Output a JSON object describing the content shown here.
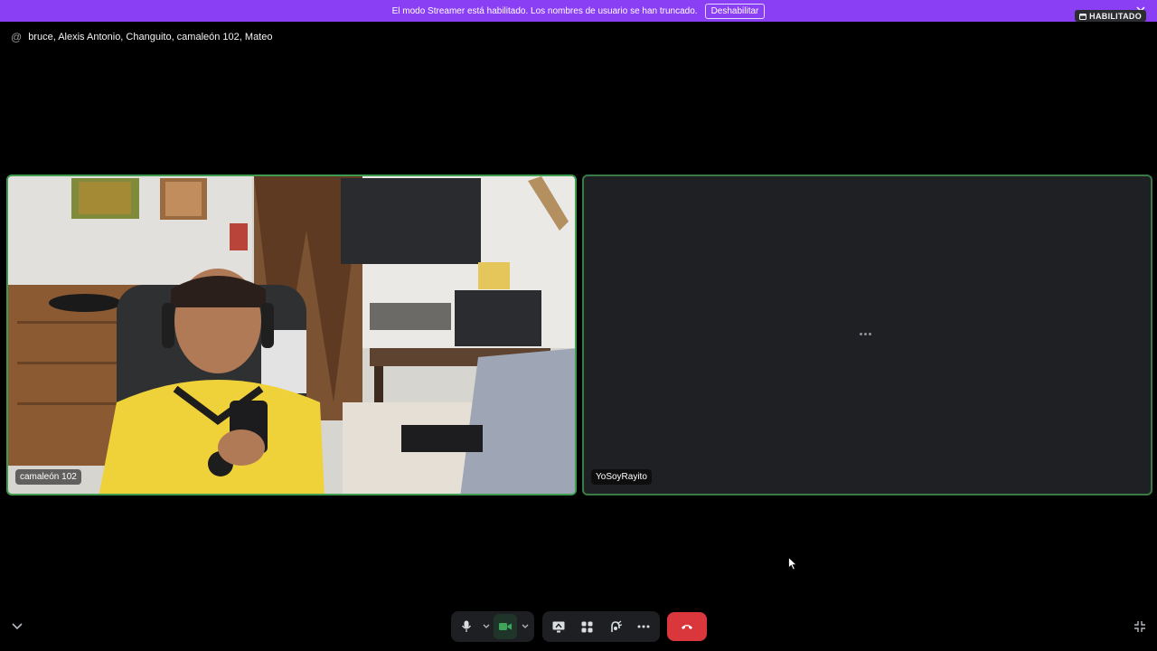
{
  "banner": {
    "message": "El modo Streamer está habilitado. Los nombres de usuario se han truncado.",
    "button_label": "Deshabilitar"
  },
  "header": {
    "at_symbol": "@",
    "participants": "bruce, Alexis Antonio, Changuito, camaleón 102, Mateo",
    "badge_label": "HABILITADO"
  },
  "tiles": [
    {
      "name": "camaleón 102",
      "video": "on"
    },
    {
      "name": "YoSoyRayito",
      "video": "loading"
    }
  ],
  "controls": {
    "mic_icon": "microphone-icon",
    "camera_icon": "camera-icon",
    "camera_active": true,
    "accent_green": "#3d9c4f",
    "hangup_color": "#da373c",
    "banner_color": "#8a3ff5"
  }
}
